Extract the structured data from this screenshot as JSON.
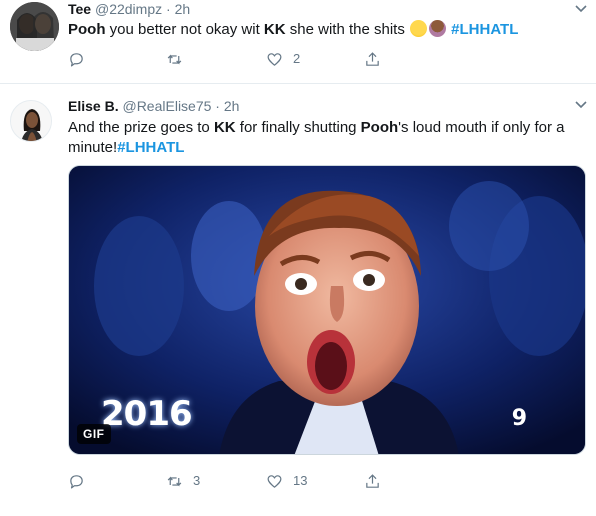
{
  "tweets": [
    {
      "name": "Tee",
      "handle": "@22dimpz",
      "time": "2h",
      "text_parts": [
        "Pooh",
        " you better not okay wit ",
        "KK",
        " she with the shits ",
        "#LHHATL"
      ],
      "actions": {
        "reply_count": "",
        "retweet_count": "",
        "like_count": "2"
      }
    },
    {
      "name": "Elise B.",
      "handle": "@RealElise75",
      "time": "2h",
      "text_parts": [
        "And the prize goes to ",
        "KK",
        " for finally shutting ",
        "Pooh",
        "'s loud mouth if only for a minute!",
        "#LHHATL"
      ],
      "media": {
        "badge": "GIF",
        "logo_year": "2016",
        "channel_logo": "9"
      },
      "actions": {
        "reply_count": "",
        "retweet_count": "3",
        "like_count": "13"
      }
    }
  ],
  "separator": " · ",
  "colors": {
    "link": "#1b95e0",
    "muted": "#657786",
    "border": "#e6ecf0"
  },
  "icons": {
    "reply": "reply-icon",
    "retweet": "retweet-icon",
    "like": "heart-icon",
    "share": "share-icon",
    "caret": "chevron-down-icon"
  }
}
